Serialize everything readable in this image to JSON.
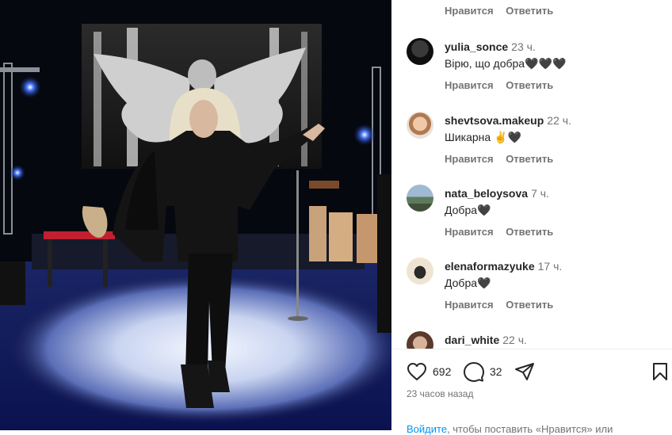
{
  "top_actions": {
    "like": "Нравится",
    "reply": "Ответить"
  },
  "comments": [
    {
      "user": "yulia_sonce",
      "time": "23 ч.",
      "text": "Вірю, що добра🖤🖤🖤",
      "like": "Нравится",
      "reply": "Ответить",
      "avatar_color": "#1b1b1b"
    },
    {
      "user": "shevtsova.makeup",
      "time": "22 ч.",
      "text": "Шикарна ✌🖤",
      "like": "Нравится",
      "reply": "Ответить",
      "avatar_color": "#d9a47e"
    },
    {
      "user": "nata_beloysova",
      "time": "7 ч.",
      "text": "Добра🖤",
      "like": "Нравится",
      "reply": "Ответить",
      "avatar_color": "#7f9db8"
    },
    {
      "user": "elenaformazyuke",
      "time": "17 ч.",
      "text": "Добра🖤",
      "like": "Нравится",
      "reply": "Ответить",
      "avatar_color": "#e8d8c0"
    },
    {
      "user": "dari_white",
      "time": "22 ч.",
      "text": "",
      "like": "",
      "reply": "",
      "avatar_color": "#6d4a3a"
    }
  ],
  "actions": {
    "likes_count": "692",
    "comments_count": "32"
  },
  "timestamp": "23 часов назад",
  "login_prompt": {
    "link": "Войдите",
    "rest": ", чтобы поставить «Нравится» или"
  },
  "icons": {
    "like": "heart-icon",
    "comment": "comment-bubble-icon",
    "share": "share-icon",
    "save": "bookmark-icon"
  },
  "colors": {
    "link": "#0095f6",
    "muted": "#737373",
    "text": "#262626"
  }
}
